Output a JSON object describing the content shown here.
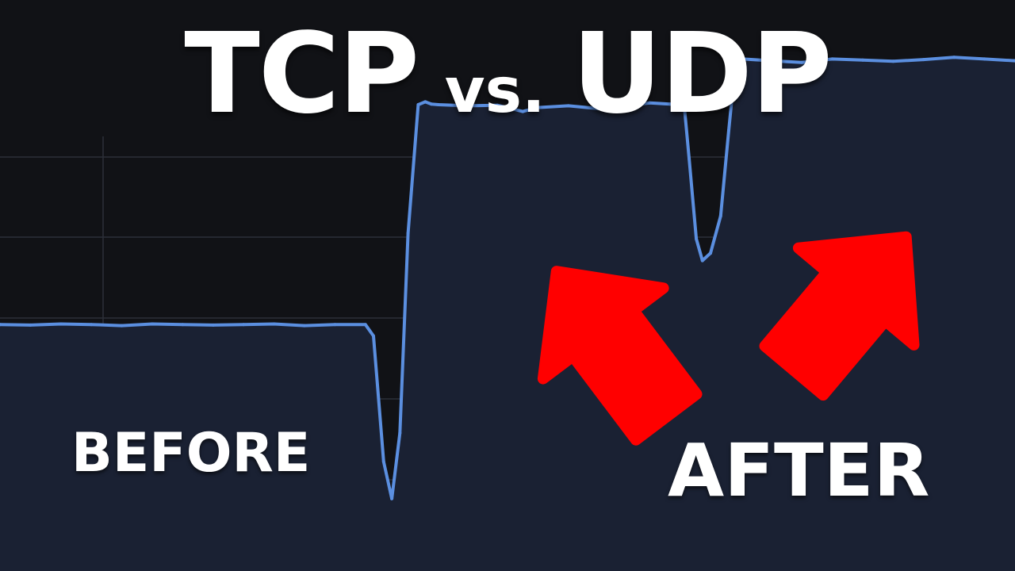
{
  "title": {
    "left": "TCP",
    "middle": "vs.",
    "right": "UDP"
  },
  "labels": {
    "before": "BEFORE",
    "after": "AFTER"
  },
  "colors": {
    "background": "#111216",
    "grid": "#2c2f38",
    "line": "#5b8fe0",
    "fill": "#1a2133",
    "arrow": "#ff0000"
  },
  "icons": [
    "up-right-arrow-icon",
    "up-right-arrow-icon"
  ],
  "chart_data": {
    "type": "line",
    "title": "",
    "xlabel": "",
    "ylabel": "",
    "xlim": [
      0,
      100
    ],
    "ylim": [
      0,
      100
    ],
    "grid": true,
    "series": [
      {
        "x": [
          0,
          3,
          6,
          9,
          12,
          15,
          18,
          21,
          24,
          27,
          30,
          33,
          36,
          36.8,
          37.8,
          38.6,
          39.4,
          40.2,
          41.2,
          41.9,
          42.5,
          43.2,
          46,
          49,
          51.5,
          53,
          56,
          59,
          62,
          64,
          66,
          67.4,
          67.9,
          68.6,
          69.2,
          70,
          71,
          71.8,
          72.5,
          73.2,
          76,
          79,
          82,
          85,
          88,
          91,
          94,
          97,
          100
        ],
        "y": [
          39,
          38.9,
          39.1,
          39,
          38.8,
          39.1,
          39,
          38.9,
          39,
          39.1,
          38.8,
          39,
          39,
          37,
          15,
          8.5,
          20,
          55,
          77.5,
          78,
          77.6,
          77.5,
          77.3,
          77.4,
          76.3,
          77,
          77.3,
          76.8,
          77.3,
          77.8,
          77.6,
          77.6,
          68,
          54,
          50.2,
          51.5,
          58,
          73,
          85.5,
          85.5,
          85.2,
          84.9,
          85.5,
          85.3,
          85.1,
          85.4,
          85.8,
          85.5,
          85.2
        ]
      }
    ]
  }
}
